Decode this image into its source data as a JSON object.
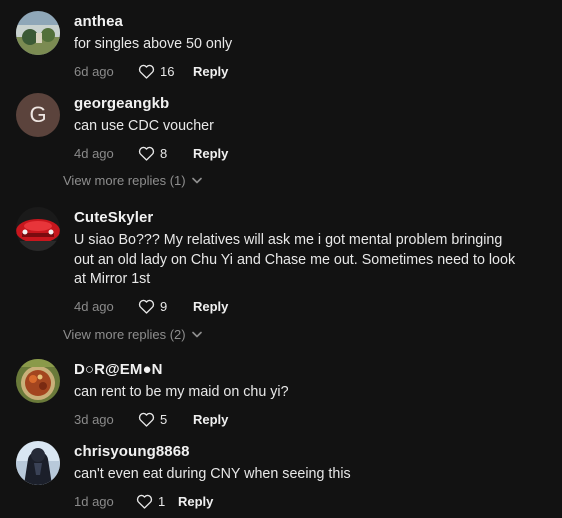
{
  "comments": [
    {
      "username": "anthea",
      "text": "for singles above 50 only",
      "time": "6d ago",
      "likes": "16",
      "reply_label": "Reply",
      "avatar": "photo-avatar"
    },
    {
      "username": "georgeangkb",
      "text": "can use CDC voucher",
      "time": "4d ago",
      "likes": "8",
      "reply_label": "Reply",
      "avatar_letter": "G"
    },
    {
      "username": "CuteSkyler",
      "text": "U siao Bo??? My relatives will ask me i got mental problem bringing out an old lady on Chu Yi and Chase me out. Sometimes need to look at Mirror 1st",
      "time": "4d ago",
      "likes": "9",
      "reply_label": "Reply",
      "avatar": "red-car-avatar"
    },
    {
      "username": "D○R@EM●N",
      "text": "can rent to be my maid on chu yi?",
      "time": "3d ago",
      "likes": "5",
      "reply_label": "Reply",
      "avatar": "food-avatar"
    },
    {
      "username": "chrisyoung8868",
      "text": "can't even eat during CNY when seeing this",
      "time": "1d ago",
      "likes": "1",
      "reply_label": "Reply",
      "avatar": "dark-figure-avatar"
    }
  ],
  "view_more": [
    {
      "label": "View more replies (1)"
    },
    {
      "label": "View more replies (2)"
    }
  ],
  "colors": {
    "background": "#121212",
    "username": "#f1f1f1",
    "muted": "#8a8a8a",
    "letter_avatar_bg": "#5b433c"
  }
}
